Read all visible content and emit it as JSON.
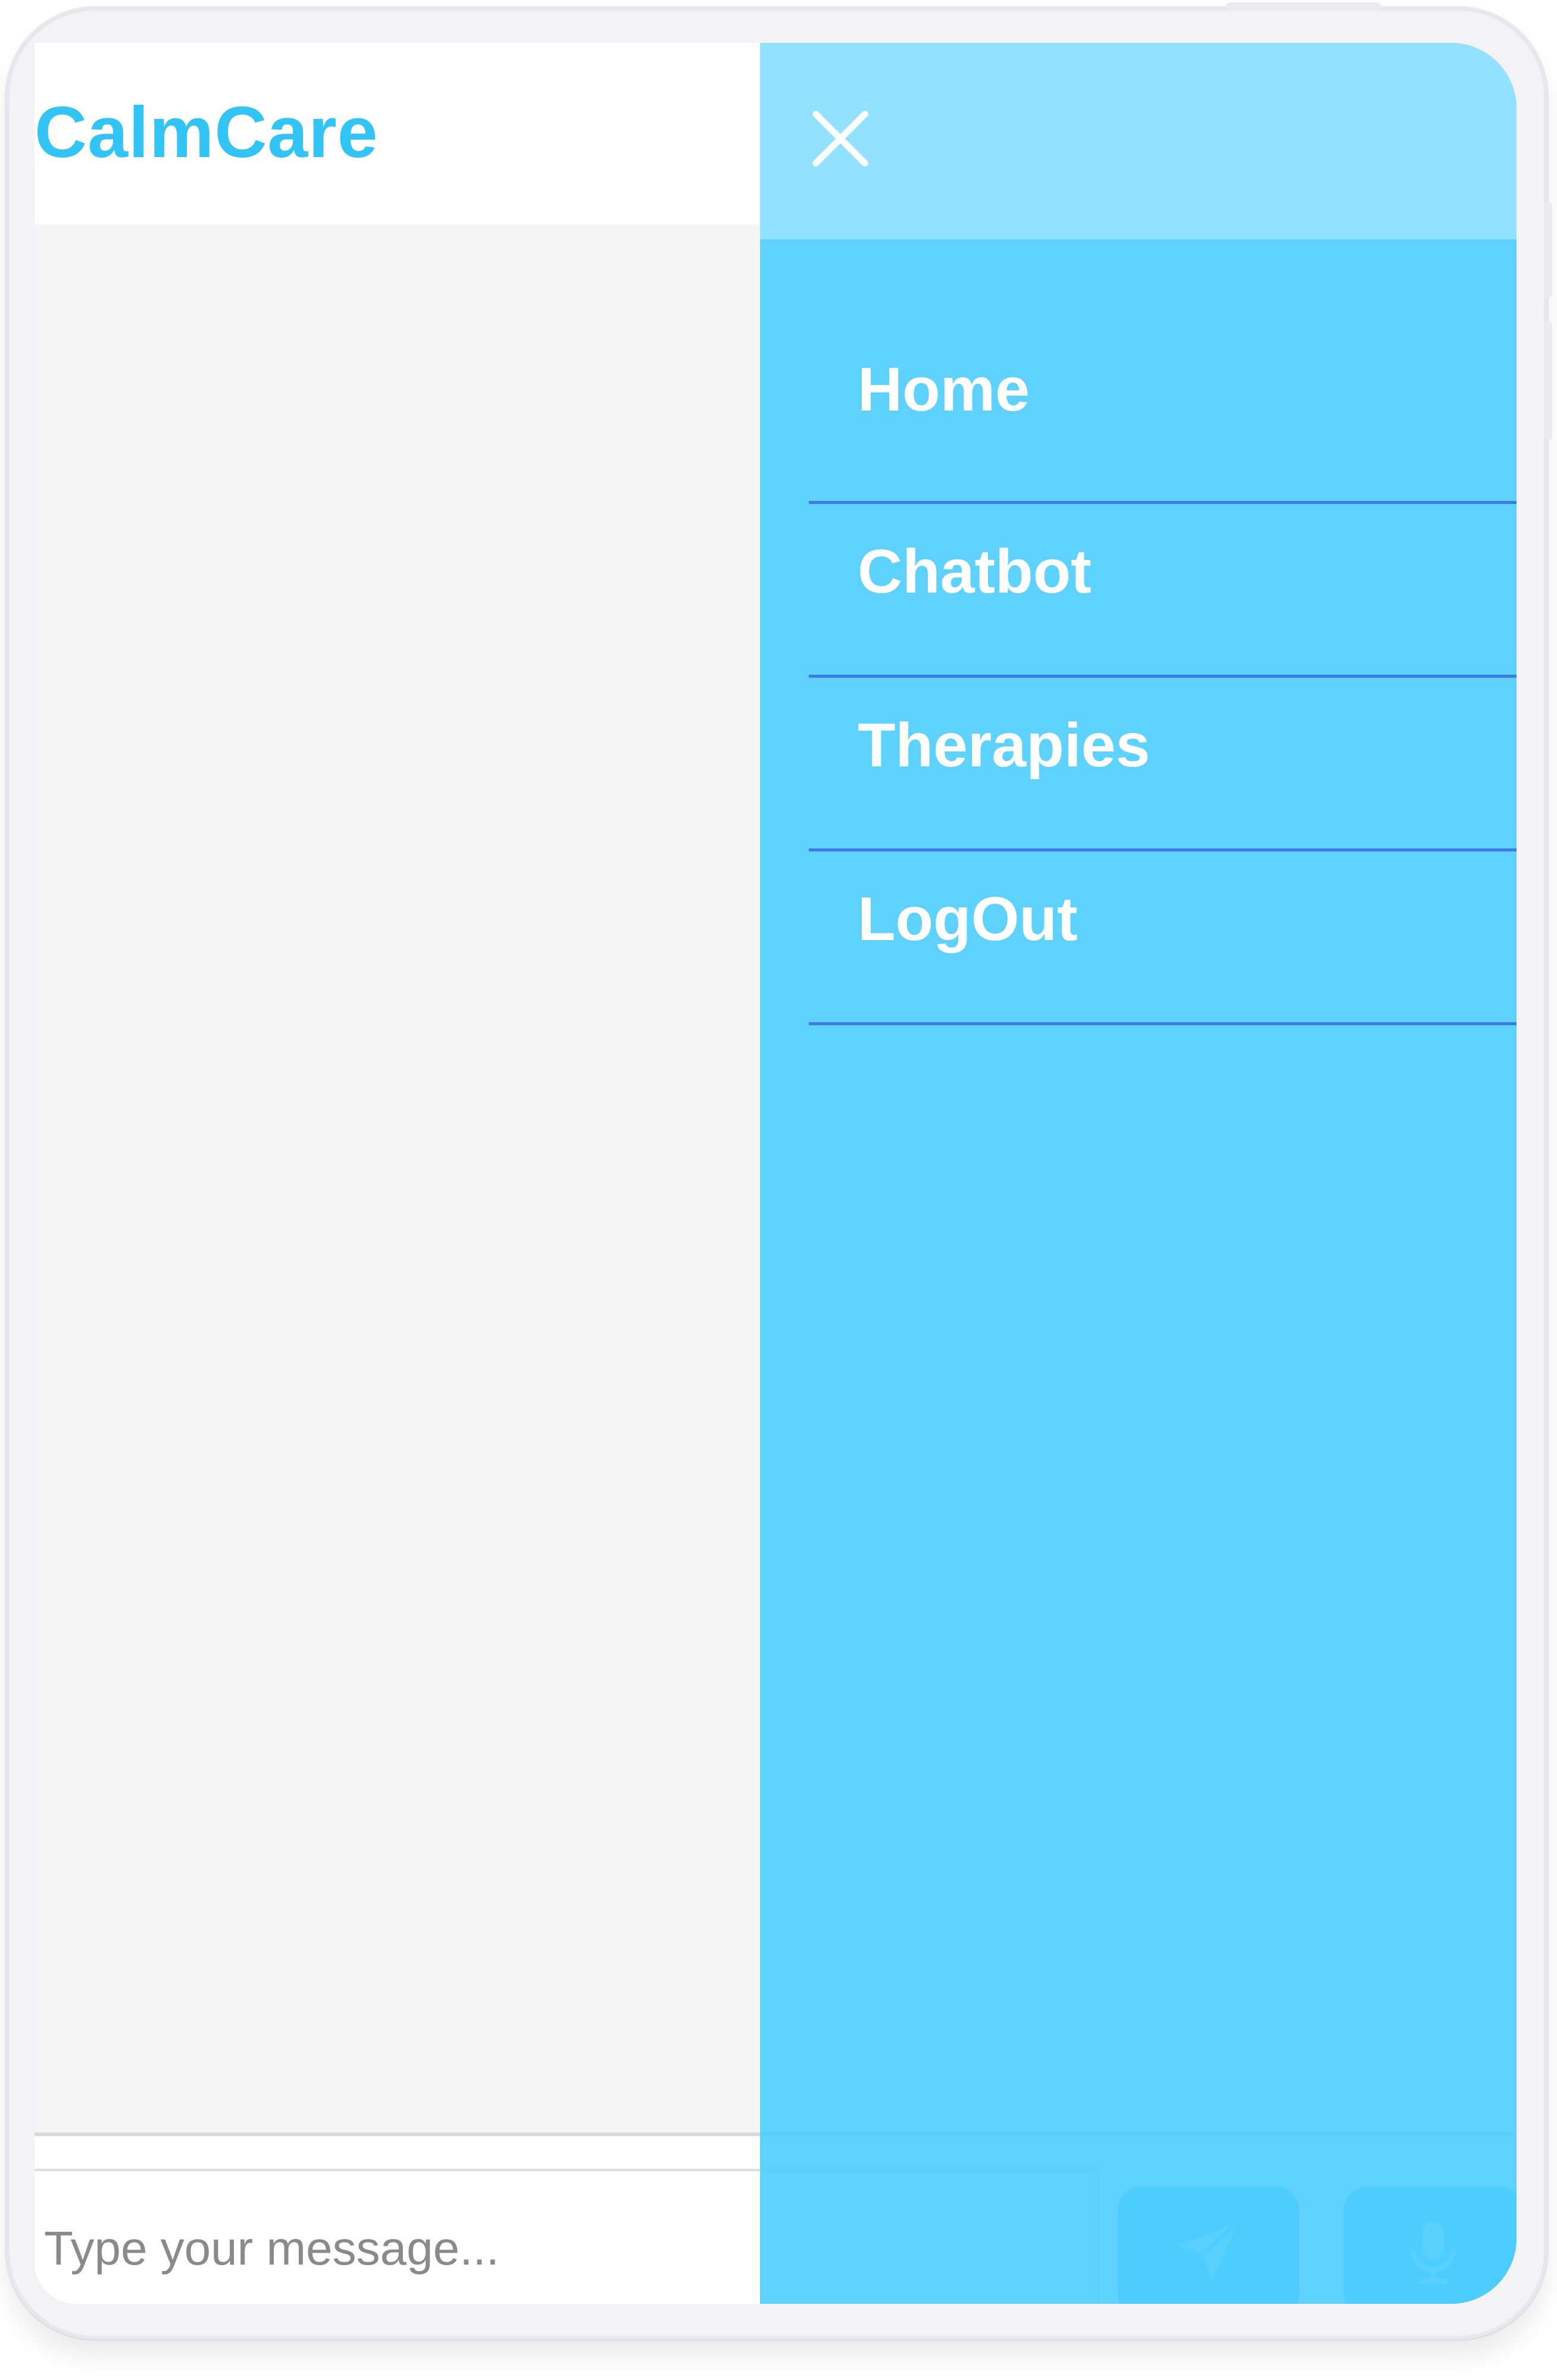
{
  "app": {
    "brand": "CalmCare",
    "accent_color": "#32c4f4"
  },
  "menu": {
    "close_icon": "close-icon",
    "items": [
      {
        "label": "Home"
      },
      {
        "label": "Chatbot"
      },
      {
        "label": "Therapies"
      },
      {
        "label": "LogOut"
      }
    ],
    "background_color": "#50cefd",
    "divider_color": "#3d79e8"
  },
  "composer": {
    "placeholder": "Type your message...",
    "value": "",
    "send_icon": "paper-plane-icon",
    "mic_icon": "microphone-icon",
    "button_color": "#2fbef9"
  }
}
